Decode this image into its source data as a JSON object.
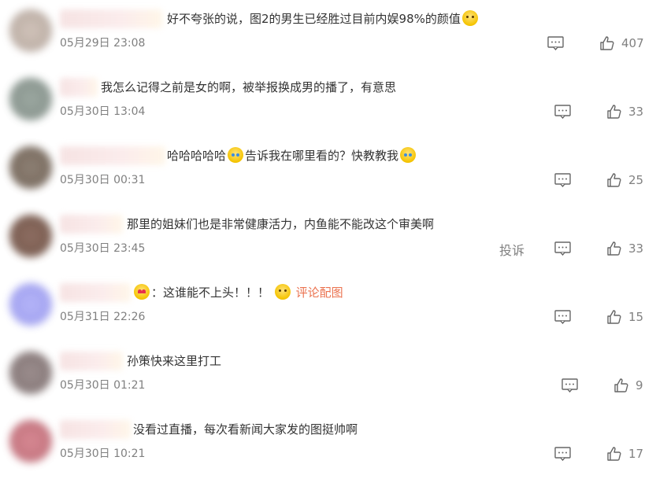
{
  "comments": [
    {
      "text": "好不夸张的说，图2的男生已经胜过目前内娱98%的颜值",
      "emoji": "sweat",
      "time": "05月29日 23:08",
      "likes": "407",
      "avatar_color": "#b8a79c",
      "name_width": 130
    },
    {
      "text": "我怎么记得之前是女的啊，被举报换成男的播了，有意思",
      "time": "05月30日 13:04",
      "likes": "33",
      "avatar_color": "#7e8c84",
      "name_width": 48
    },
    {
      "parts": [
        "哈哈哈哈哈",
        "告诉我在哪里看的？快教教我"
      ],
      "emoji": "laugh",
      "time": "05月30日 00:31",
      "likes": "25",
      "avatar_color": "#6a5a4c",
      "name_width": 134
    },
    {
      "text": "那里的姐妹们也是非常健康活力，内鱼能不能改这个审美啊",
      "time": "05月30日 23:45",
      "likes": "33",
      "report": "投诉",
      "avatar_color": "#6d4a3c",
      "name_width": 80
    },
    {
      "prefix": "：这谁能不上头！！！",
      "link": "评论配图",
      "time": "05月31日 22:26",
      "likes": "15",
      "avatar_color": "#9c9cf0",
      "name_width": 90
    },
    {
      "text": "孙策快来这里打工",
      "time": "05月30日 01:21",
      "likes": "9",
      "avatar_color": "#7a6a6a",
      "name_width": 80
    },
    {
      "text": "没看过直播，每次看新闻大家发的图挺帅啊",
      "time": "05月30日 10:21",
      "likes": "17",
      "avatar_color": "#c2646f",
      "name_width": 90
    }
  ],
  "icons": {
    "comment": "comment-icon",
    "like": "thumbs-up-icon",
    "emoji": "emoji-icon"
  }
}
